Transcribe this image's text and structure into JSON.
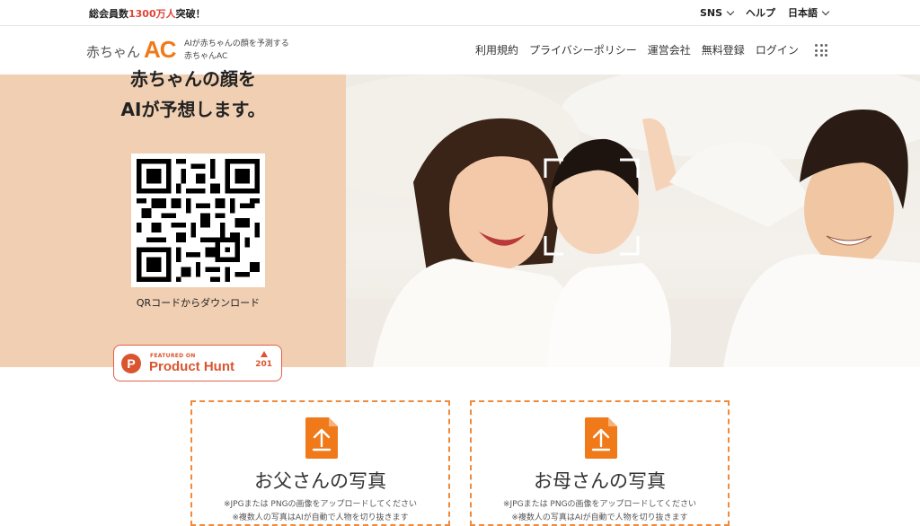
{
  "topbar": {
    "members_prefix": "総会員数",
    "members_count": "1300万人",
    "members_suffix": "突破！",
    "sns": "SNS",
    "help": "ヘルプ",
    "language": "日本語"
  },
  "header": {
    "logo_jp": "赤ちゃん",
    "logo_ac": "AC",
    "tagline_line1": "AIが赤ちゃんの顔を予測する",
    "tagline_line2": "赤ちゃんAC",
    "nav": [
      "利用規約",
      "プライバシーポリシー",
      "運営会社",
      "無料登録",
      "ログイン"
    ],
    "apps_icon": "grid-apps-icon"
  },
  "hero": {
    "title_line1": "赤ちゃんの顔を",
    "title_line2": "AIが予想します。",
    "qr_caption": "QRコードからダウンロード",
    "product_hunt": {
      "featured": "FEATURED ON",
      "name": "Product Hunt",
      "logo_letter": "P",
      "votes": "201"
    }
  },
  "upload": {
    "father": {
      "title": "お父さんの写真",
      "note1": "※JPGまたは PNGの画像をアップロードしてください",
      "note2": "※複数人の写真はAIが自動で人物を切り抜きます"
    },
    "mother": {
      "title": "お母さんの写真",
      "note1": "※JPGまたは PNGの画像をアップロードしてください",
      "note2": "※複数人の写真はAIが自動で人物を切り抜きます"
    }
  },
  "colors": {
    "accent": "#f07a1a",
    "hero_bg": "#f0cfb2",
    "highlight": "#e0453a",
    "product_hunt": "#da552f"
  }
}
